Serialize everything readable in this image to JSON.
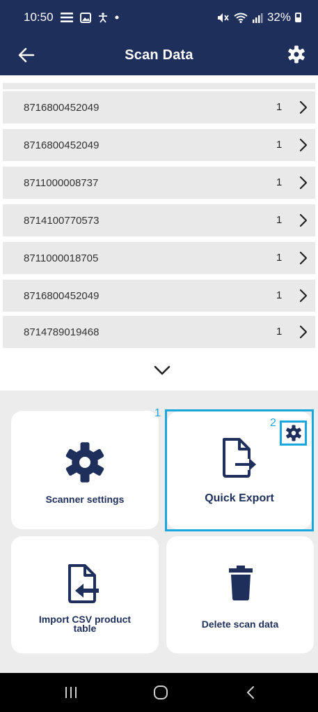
{
  "status": {
    "time": "10:50",
    "battery": "32%"
  },
  "appbar": {
    "title": "Scan Data"
  },
  "rows": [
    {
      "code": "8716800452049",
      "qty": "1"
    },
    {
      "code": "8716800452049",
      "qty": "1"
    },
    {
      "code": "8711000008737",
      "qty": "1"
    },
    {
      "code": "8714100770573",
      "qty": "1"
    },
    {
      "code": "8711000018705",
      "qty": "1"
    },
    {
      "code": "8716800452049",
      "qty": "1"
    },
    {
      "code": "8714789019468",
      "qty": "1"
    }
  ],
  "tiles": {
    "scanner_settings": "Scanner settings",
    "quick_export": "Quick Export",
    "import_csv_line1": "Import CSV product",
    "import_csv_line2": "table",
    "delete_scan_data": "Delete scan data"
  },
  "callouts": {
    "one": "1",
    "two": "2"
  },
  "colors": {
    "primary": "#1f2f5c",
    "highlight": "#1aa7e0",
    "row_bg": "#e9e9e9",
    "tiles_bg": "#ececec"
  },
  "icons": [
    "back-arrow-icon",
    "gear-icon",
    "chevron-right-icon",
    "chevron-down-icon",
    "file-export-icon",
    "file-import-icon",
    "trash-icon"
  ]
}
